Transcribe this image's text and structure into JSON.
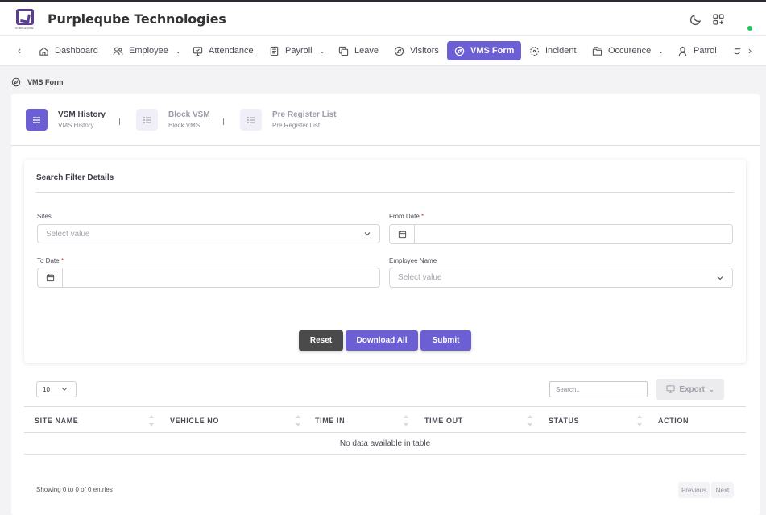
{
  "app": {
    "brand": "Purpleqube Technologies",
    "logo_sub": "PURPLEQUBE"
  },
  "nav": {
    "items": [
      {
        "label": "Dashboard"
      },
      {
        "label": "Employee"
      },
      {
        "label": "Attendance"
      },
      {
        "label": "Payroll"
      },
      {
        "label": "Leave"
      },
      {
        "label": "Visitors"
      },
      {
        "label": "VMS Form"
      },
      {
        "label": "Incident"
      },
      {
        "label": "Occurence"
      },
      {
        "label": "Patrol"
      }
    ],
    "active": "VMS Form"
  },
  "breadcrumb": {
    "label": "VMS Form"
  },
  "tabs": [
    {
      "title": "VSM History",
      "sub": "VMS History"
    },
    {
      "title": "Block VSM",
      "sub": "Block VMS"
    },
    {
      "title": "Pre Register List",
      "sub": "Pre Register List"
    }
  ],
  "filter": {
    "title": "Search Filter Details",
    "sites_label": "Sites",
    "sites_placeholder": "Select value",
    "from_date_label": "From Date",
    "to_date_label": "To Date",
    "employee_label": "Employee Name",
    "employee_placeholder": "Select value",
    "required_mark": "*",
    "reset_label": "Reset",
    "download_label": "Download All",
    "submit_label": "Submit"
  },
  "table": {
    "page_length": "10",
    "search_placeholder": "Search..",
    "export_label": "Export",
    "columns": [
      "SITE NAME",
      "VEHICLE NO",
      "TIME IN",
      "TIME OUT",
      "STATUS",
      "ACTION"
    ],
    "empty_text": "No data available in table",
    "info": "Showing 0 to 0 of 0 entries",
    "prev_label": "Previous",
    "next_label": "Next"
  },
  "colors": {
    "accent": "#6c5fd3",
    "reset": "#4a4a4a",
    "online": "#22c55e"
  }
}
